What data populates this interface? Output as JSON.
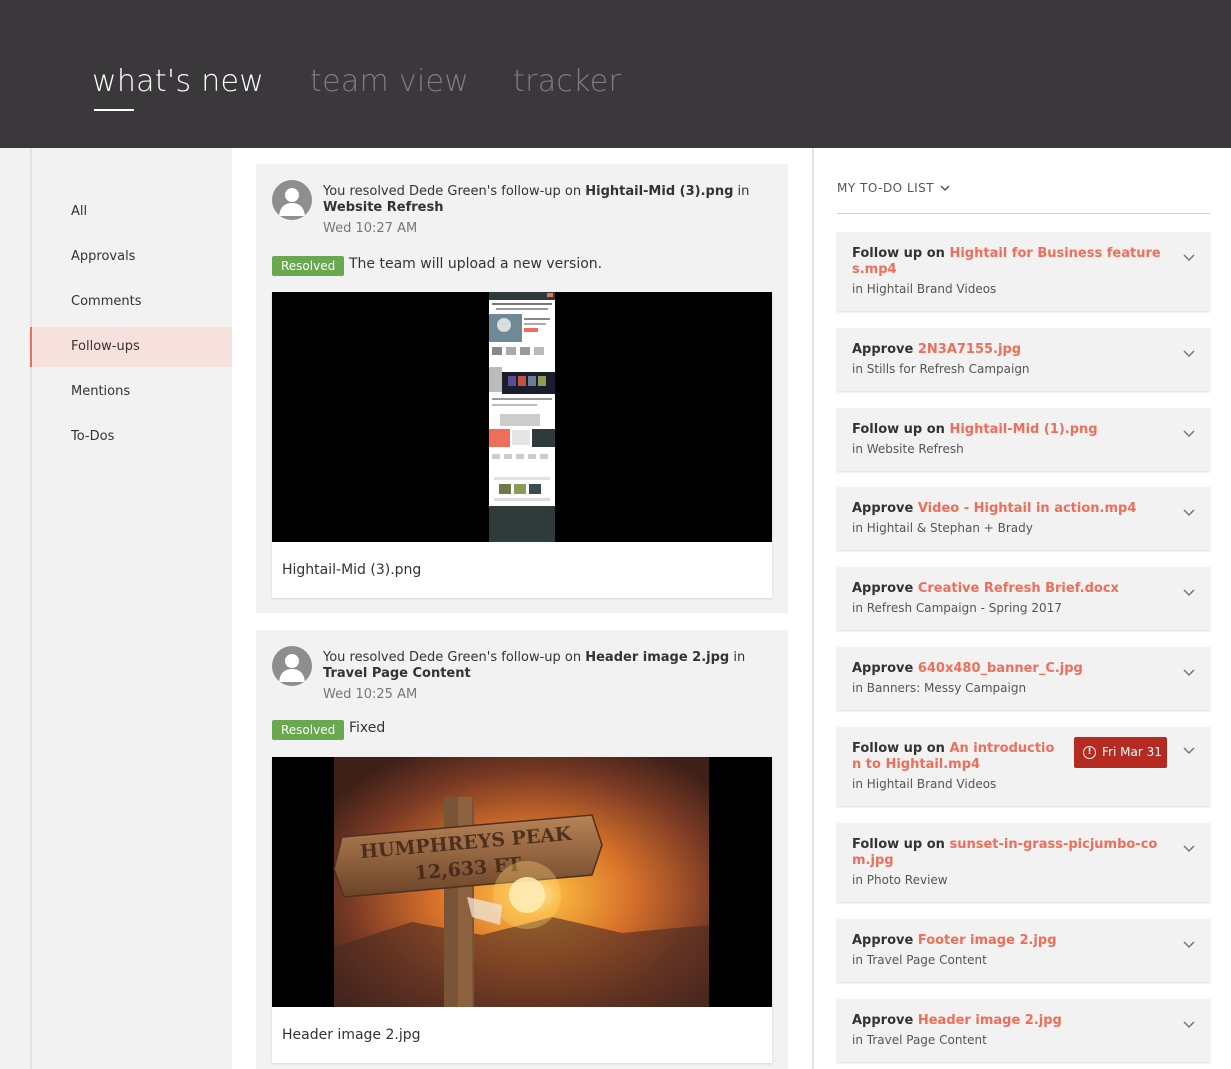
{
  "tabs": [
    {
      "label": "what's new",
      "active": true
    },
    {
      "label": "team view",
      "active": false
    },
    {
      "label": "tracker",
      "active": false
    }
  ],
  "nav": {
    "items": [
      {
        "label": "All"
      },
      {
        "label": "Approvals"
      },
      {
        "label": "Comments"
      },
      {
        "label": "Follow-ups",
        "active": true
      },
      {
        "label": "Mentions"
      },
      {
        "label": "To-Dos"
      }
    ]
  },
  "feed": [
    {
      "prefix": "You resolved Dede Green's follow-up on ",
      "file": "Hightail-Mid (3).png",
      "in": " in",
      "project": "Website Refresh",
      "time": "Wed 10:27 AM",
      "badge": "Resolved",
      "message": "The team will upload a new version.",
      "caption": "Hightail-Mid (3).png"
    },
    {
      "prefix": "You resolved Dede Green's follow-up on ",
      "file": "Header image 2.jpg",
      "in": " in",
      "project": "Travel Page Content",
      "time": "Wed 10:25 AM",
      "badge": "Resolved",
      "message": "Fixed",
      "caption": "Header image 2.jpg",
      "sign_text": {
        "line1": "HUMPHREYS PEAK",
        "line2": "12,633 FT"
      }
    }
  ],
  "todo": {
    "header": "MY TO-DO LIST",
    "items": [
      {
        "action": "Follow up on ",
        "file": "Hightail for Business features.mp4",
        "project": "in Hightail Brand Videos"
      },
      {
        "action": "Approve ",
        "file": "2N3A7155.jpg",
        "project": "in Stills for Refresh Campaign"
      },
      {
        "action": "Follow up on ",
        "file": "Hightail-Mid (1).png",
        "project": "in Website Refresh"
      },
      {
        "action": "Approve ",
        "file": "Video - Hightail in action.mp4",
        "project": "in Hightail & Stephan + Brady"
      },
      {
        "action": "Approve ",
        "file": "Creative Refresh Brief.docx",
        "project": "in Refresh Campaign - Spring 2017"
      },
      {
        "action": "Approve ",
        "file": "640x480_banner_C.jpg",
        "project": "in Banners: Messy Campaign"
      },
      {
        "action": "Follow up on ",
        "file": "An introduction to Hightail.mp4",
        "project": "in Hightail Brand Videos",
        "due": "Fri Mar 31"
      },
      {
        "action": "Follow up on ",
        "file": "sunset-in-grass-picjumbo-com.jpg",
        "project": "in Photo Review"
      },
      {
        "action": "Approve ",
        "file": "Footer image 2.jpg",
        "project": "in Travel Page Content"
      },
      {
        "action": "Approve ",
        "file": "Header image 2.jpg",
        "project": "in Travel Page Content"
      }
    ]
  },
  "colors": {
    "header_bg": "#3a383b",
    "accent": "#ef6e5a",
    "resolved": "#6aa84f",
    "due_bg": "#b62b21"
  }
}
